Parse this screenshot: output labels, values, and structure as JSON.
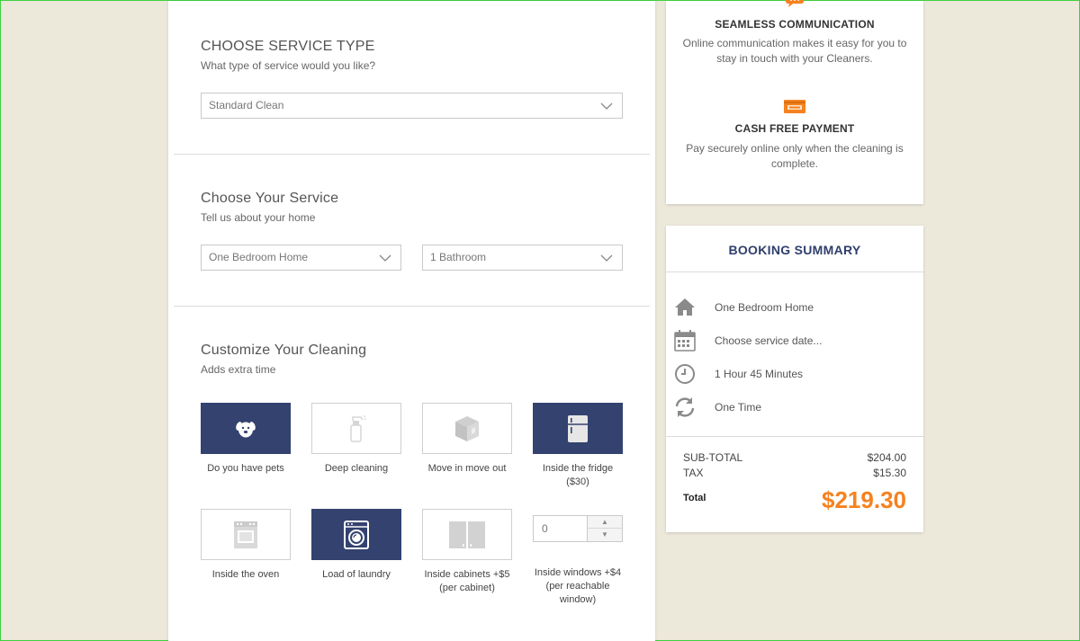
{
  "service_type": {
    "title": "CHOOSE SERVICE TYPE",
    "subtitle": "What type of service would you like?",
    "selected": "Standard Clean"
  },
  "your_service": {
    "title": "Choose Your Service",
    "subtitle": "Tell us about your home",
    "bedrooms": "One Bedroom Home",
    "bathrooms": "1 Bathroom"
  },
  "customize": {
    "title": "Customize Your Cleaning",
    "subtitle": "Adds extra time",
    "extras": [
      {
        "label": "Do you have pets",
        "icon": "dog-icon",
        "selected": true
      },
      {
        "label": "Deep cleaning",
        "icon": "spray-bottle-icon",
        "selected": false
      },
      {
        "label": "Move in move out",
        "icon": "box-icon",
        "selected": false
      },
      {
        "label": "Inside the fridge ($30)",
        "icon": "fridge-icon",
        "selected": true
      },
      {
        "label": "Inside the oven",
        "icon": "oven-icon",
        "selected": false
      },
      {
        "label": "Load of laundry",
        "icon": "washing-machine-icon",
        "selected": true
      },
      {
        "label": "Inside cabinets +$5 (per cabinet)",
        "icon": "cabinet-icon",
        "selected": false
      }
    ],
    "windows": {
      "label": "Inside windows +$4 (per reachable window)",
      "value": "0"
    }
  },
  "features": [
    {
      "title": "SEAMLESS COMMUNICATION",
      "text": "Online communication makes it easy for you to stay in touch with your Cleaners.",
      "icon": "chat-icon"
    },
    {
      "title": "CASH FREE PAYMENT",
      "text": "Pay securely online only when the cleaning is complete.",
      "icon": "credit-card-icon"
    }
  ],
  "summary": {
    "title": "BOOKING SUMMARY",
    "rows": [
      {
        "icon": "home-icon",
        "text": "One Bedroom Home"
      },
      {
        "icon": "calendar-icon",
        "text": "Choose service date..."
      },
      {
        "icon": "clock-icon",
        "text": "1 Hour 45 Minutes"
      },
      {
        "icon": "refresh-icon",
        "text": "One Time"
      }
    ],
    "subtotal_label": "SUB-TOTAL",
    "subtotal": "$204.00",
    "tax_label": "TAX",
    "tax": "$15.30",
    "total_label": "Total",
    "total": "$219.30"
  },
  "colors": {
    "accent": "#33426f",
    "total": "#f5821f",
    "background": "#ece8da"
  }
}
